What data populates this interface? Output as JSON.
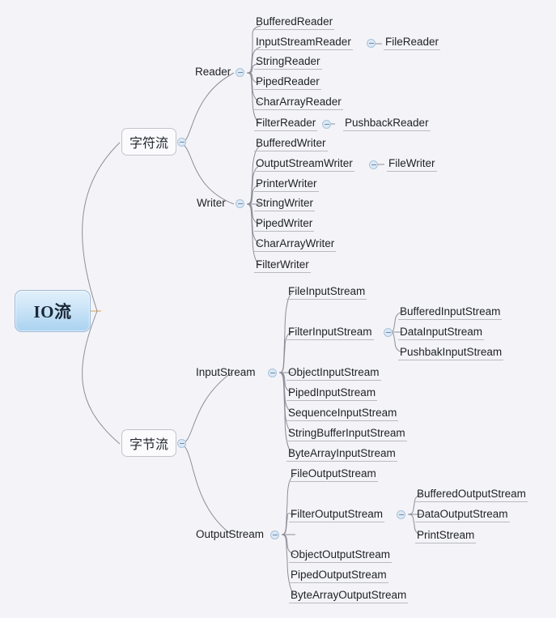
{
  "diagram": {
    "title": "IO流",
    "type": "mindmap",
    "background_color": "#f4f4f8",
    "root_color": "#a9d2f0",
    "line_color": "#8d8d98"
  },
  "root": {
    "label": "IO流"
  },
  "branches": [
    {
      "label": "字符流",
      "groups": [
        {
          "label": "Reader",
          "toggle": "collapse-toggle",
          "children": [
            {
              "label": "BufferedReader",
              "children": []
            },
            {
              "label": "InputStreamReader",
              "toggle": "collapse-toggle",
              "children": [
                {
                  "label": "FileReader"
                }
              ]
            },
            {
              "label": "StringReader",
              "children": []
            },
            {
              "label": "PipedReader",
              "children": []
            },
            {
              "label": "CharArrayReader",
              "children": []
            },
            {
              "label": "FilterReader",
              "toggle": "collapse-toggle",
              "children": [
                {
                  "label": "PushbackReader"
                }
              ]
            }
          ]
        },
        {
          "label": "Writer",
          "toggle": "collapse-toggle",
          "children": [
            {
              "label": "BufferedWriter",
              "children": []
            },
            {
              "label": "OutputStreamWriter",
              "toggle": "collapse-toggle",
              "children": [
                {
                  "label": "FileWriter"
                }
              ]
            },
            {
              "label": "PrinterWriter",
              "children": []
            },
            {
              "label": "StringWriter",
              "children": []
            },
            {
              "label": "PipedWriter",
              "children": []
            },
            {
              "label": "CharArrayWriter",
              "children": []
            },
            {
              "label": "FilterWriter",
              "children": []
            }
          ]
        }
      ]
    },
    {
      "label": "字节流",
      "groups": [
        {
          "label": "InputStream",
          "toggle": "collapse-toggle",
          "children": [
            {
              "label": "FileInputStream",
              "children": []
            },
            {
              "label": "FilterInputStream",
              "toggle": "collapse-toggle",
              "children": [
                {
                  "label": "BufferedInputStream"
                },
                {
                  "label": "DataInputStream"
                },
                {
                  "label": "PushbakInputStream"
                }
              ]
            },
            {
              "label": "ObjectInputStream",
              "children": []
            },
            {
              "label": "PipedInputStream",
              "children": []
            },
            {
              "label": "SequenceInputStream",
              "children": []
            },
            {
              "label": "StringBufferInputStream",
              "children": []
            },
            {
              "label": "ByteArrayInputStream",
              "children": []
            }
          ]
        },
        {
          "label": "OutputStream",
          "toggle": "collapse-toggle",
          "children": [
            {
              "label": "FileOutputStream",
              "children": []
            },
            {
              "label": "FilterOutputStream",
              "toggle": "collapse-toggle",
              "children": [
                {
                  "label": "BufferedOutputStream"
                },
                {
                  "label": "DataOutputStream"
                },
                {
                  "label": "PrintStream"
                }
              ]
            },
            {
              "label": "ObjectOutputStream",
              "children": []
            },
            {
              "label": "PipedOutputStream",
              "children": []
            },
            {
              "label": "ByteArrayOutputStream",
              "children": []
            }
          ]
        }
      ]
    }
  ],
  "nodes": {
    "root": "IO流",
    "char_stream": "字符流",
    "byte_stream": "字节流",
    "reader": "Reader",
    "writer": "Writer",
    "input_stream": "InputStream",
    "output_stream": "OutputStream",
    "buffered_reader": "BufferedReader",
    "input_stream_reader": "InputStreamReader",
    "file_reader": "FileReader",
    "string_reader": "StringReader",
    "piped_reader": "PipedReader",
    "char_array_reader": "CharArrayReader",
    "filter_reader": "FilterReader",
    "pushback_reader": "PushbackReader",
    "buffered_writer": "BufferedWriter",
    "output_stream_writer": "OutputStreamWriter",
    "file_writer": "FileWriter",
    "printer_writer": "PrinterWriter",
    "string_writer": "StringWriter",
    "piped_writer": "PipedWriter",
    "char_array_writer": "CharArrayWriter",
    "filter_writer": "FilterWriter",
    "file_input_stream": "FileInputStream",
    "filter_input_stream": "FilterInputStream",
    "buffered_input_stream": "BufferedInputStream",
    "data_input_stream": "DataInputStream",
    "pushbak_input_stream": "PushbakInputStream",
    "object_input_stream": "ObjectInputStream",
    "piped_input_stream": "PipedInputStream",
    "sequence_input_stream": "SequenceInputStream",
    "string_buffer_input_stream": "StringBufferInputStream",
    "byte_array_input_stream": "ByteArrayInputStream",
    "file_output_stream": "FileOutputStream",
    "filter_output_stream": "FilterOutputStream",
    "buffered_output_stream": "BufferedOutputStream",
    "data_output_stream": "DataOutputStream",
    "print_stream": "PrintStream",
    "object_output_stream": "ObjectOutputStream",
    "piped_output_stream": "PipedOutputStream",
    "byte_array_output_stream": "ByteArrayOutputStream"
  }
}
